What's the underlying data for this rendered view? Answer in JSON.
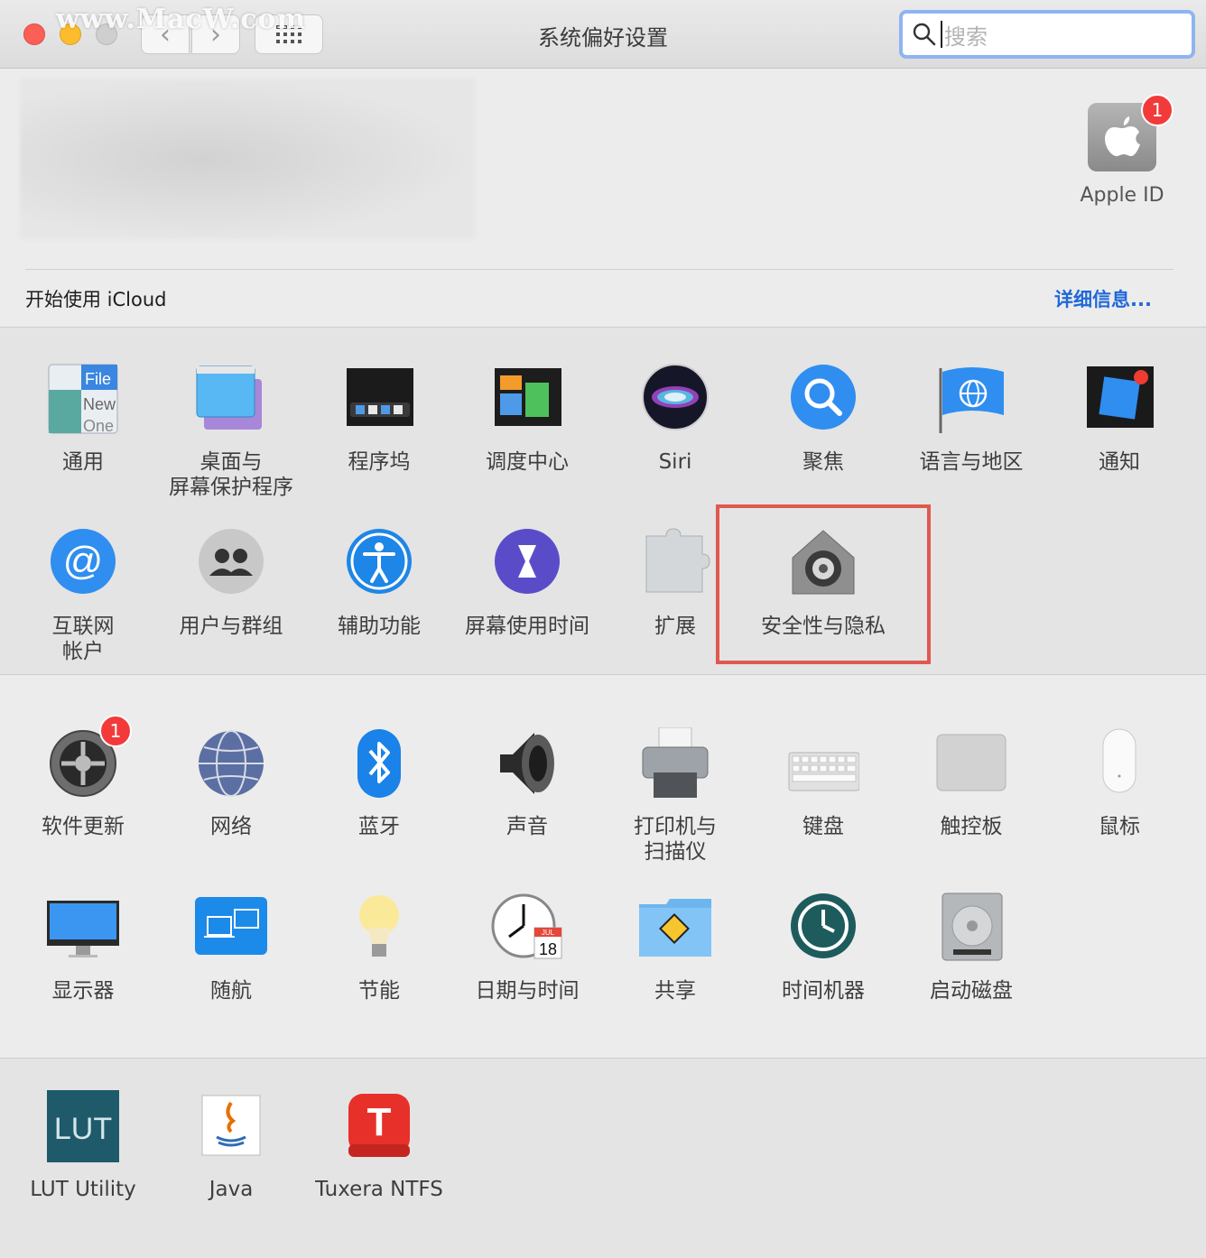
{
  "window": {
    "title": "系统偏好设置",
    "watermark": "www.MacW.com"
  },
  "colors": {
    "accent": "#2068d9",
    "badge": "#f33a3a",
    "highlight": "#e0584f"
  },
  "toolbar": {
    "back_glyph": "‹",
    "forward_glyph": "›",
    "search_placeholder": "搜索"
  },
  "account": {
    "apple_id_label": "Apple ID",
    "apple_id_badge": "1",
    "icloud_text": "开始使用 iCloud",
    "details_link": "详细信息..."
  },
  "panes": {
    "general": {
      "label": "通用",
      "icon": "general-icon"
    },
    "desktop": {
      "label": "桌面与\n屏幕保护程序",
      "icon": "desktop-screensaver-icon"
    },
    "dock": {
      "label": "程序坞",
      "icon": "dock-icon"
    },
    "mission": {
      "label": "调度中心",
      "icon": "mission-control-icon"
    },
    "siri": {
      "label": "Siri",
      "icon": "siri-icon"
    },
    "spotlight": {
      "label": "聚焦",
      "icon": "spotlight-icon"
    },
    "language": {
      "label": "语言与地区",
      "icon": "language-region-icon"
    },
    "notifications": {
      "label": "通知",
      "icon": "notifications-icon"
    },
    "internet": {
      "label": "互联网\n帐户",
      "icon": "internet-accounts-icon"
    },
    "users": {
      "label": "用户与群组",
      "icon": "users-groups-icon"
    },
    "accessibility": {
      "label": "辅助功能",
      "icon": "accessibility-icon"
    },
    "screentime": {
      "label": "屏幕使用时间",
      "icon": "screen-time-icon"
    },
    "extensions": {
      "label": "扩展",
      "icon": "extensions-icon"
    },
    "security": {
      "label": "安全性与隐私",
      "icon": "security-privacy-icon"
    },
    "software_update": {
      "label": "软件更新",
      "icon": "software-update-icon",
      "badge": "1"
    },
    "network": {
      "label": "网络",
      "icon": "network-icon"
    },
    "bluetooth": {
      "label": "蓝牙",
      "icon": "bluetooth-icon"
    },
    "sound": {
      "label": "声音",
      "icon": "sound-icon"
    },
    "printers": {
      "label": "打印机与\n扫描仪",
      "icon": "printer-scanner-icon"
    },
    "keyboard": {
      "label": "键盘",
      "icon": "keyboard-icon"
    },
    "trackpad": {
      "label": "触控板",
      "icon": "trackpad-icon"
    },
    "mouse": {
      "label": "鼠标",
      "icon": "mouse-icon"
    },
    "displays": {
      "label": "显示器",
      "icon": "displays-icon"
    },
    "sidecar": {
      "label": "随航",
      "icon": "sidecar-icon"
    },
    "energy": {
      "label": "节能",
      "icon": "energy-saver-icon"
    },
    "datetime": {
      "label": "日期与时间",
      "icon": "date-time-icon",
      "month": "JUL",
      "day": "18"
    },
    "sharing": {
      "label": "共享",
      "icon": "sharing-icon"
    },
    "timemachine": {
      "label": "时间机器",
      "icon": "time-machine-icon"
    },
    "startup": {
      "label": "启动磁盘",
      "icon": "startup-disk-icon"
    },
    "lut": {
      "label": "LUT Utility",
      "icon": "lut-utility-icon",
      "icon_text": "LUT"
    },
    "java": {
      "label": "Java",
      "icon": "java-icon"
    },
    "tuxera": {
      "label": "Tuxera NTFS",
      "icon": "tuxera-ntfs-icon",
      "icon_text": "T"
    }
  },
  "general_icon_text": [
    "File",
    "New",
    "One"
  ]
}
